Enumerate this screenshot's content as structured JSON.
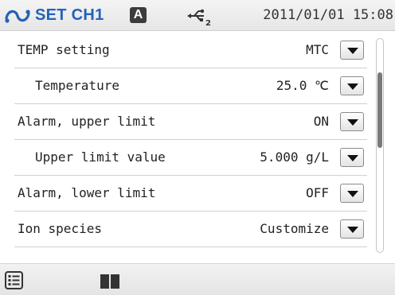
{
  "header": {
    "icon": "probe-icon",
    "title": "SET CH1",
    "mode_badge": "A",
    "usb_icon": "usb-icon",
    "usb_subscript": "2",
    "datetime": "2011/01/01 15:08"
  },
  "settings": [
    {
      "label": "TEMP setting",
      "value": "MTC"
    },
    {
      "label": "Temperature",
      "value": "25.0 ℃"
    },
    {
      "label": "Alarm, upper limit",
      "value": "ON"
    },
    {
      "label": "Upper limit value",
      "value": "5.000 g/L"
    },
    {
      "label": "Alarm, lower limit",
      "value": "OFF"
    },
    {
      "label": "Ion species",
      "value": "Customize"
    }
  ],
  "footer": {
    "menu_icon": "list-menu-icon",
    "book_icon": "book-icon"
  },
  "colors": {
    "accent": "#2462b8",
    "badge": "#3c3c3c",
    "header_bg": "#ececec",
    "divider": "#d0d0d0"
  }
}
